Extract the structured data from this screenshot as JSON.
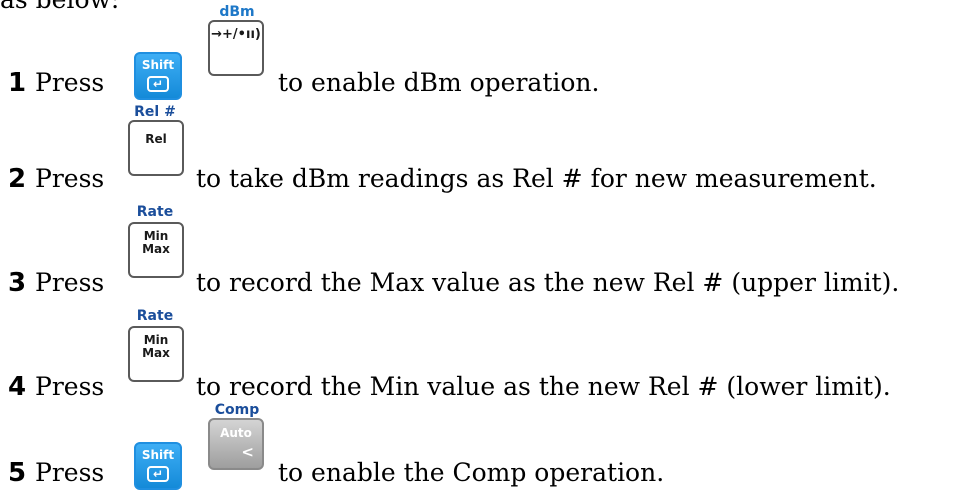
{
  "intro": "as below:",
  "colors": {
    "shift_key": "#1e90e6",
    "alt_label": "#1e78c8",
    "alt_label_dark": "#1b4e9b",
    "gray_key": "#b0b0b0"
  },
  "steps": [
    {
      "number": "1",
      "press": "Press",
      "keys": [
        {
          "type": "shift",
          "label": "Shift",
          "icon": "enter-icon"
        },
        {
          "label": "→+/•ıı)",
          "icon": "diode-continuity-icon",
          "alt_label": "dBm"
        }
      ],
      "text": "to enable dBm operation."
    },
    {
      "number": "2",
      "press": "Press",
      "keys": [
        {
          "label": "Rel",
          "alt_label": "Rel #"
        }
      ],
      "text": "to take dBm readings as Rel # for new measurement."
    },
    {
      "number": "3",
      "press": "Press",
      "keys": [
        {
          "label_lines": [
            "Min",
            "Max"
          ],
          "alt_label": "Rate"
        }
      ],
      "text": "to record the Max value as the new Rel # (upper limit)."
    },
    {
      "number": "4",
      "press": "Press",
      "keys": [
        {
          "label_lines": [
            "Min",
            "Max"
          ],
          "alt_label": "Rate"
        }
      ],
      "text": "to record the Min value as the new Rel # (lower limit)."
    },
    {
      "number": "5",
      "press": "Press",
      "keys": [
        {
          "type": "shift",
          "label": "Shift",
          "icon": "enter-icon"
        },
        {
          "type": "gray",
          "label": "Auto",
          "symbol": "<",
          "alt_label": "Comp"
        }
      ],
      "text": "to enable the Comp operation."
    }
  ]
}
